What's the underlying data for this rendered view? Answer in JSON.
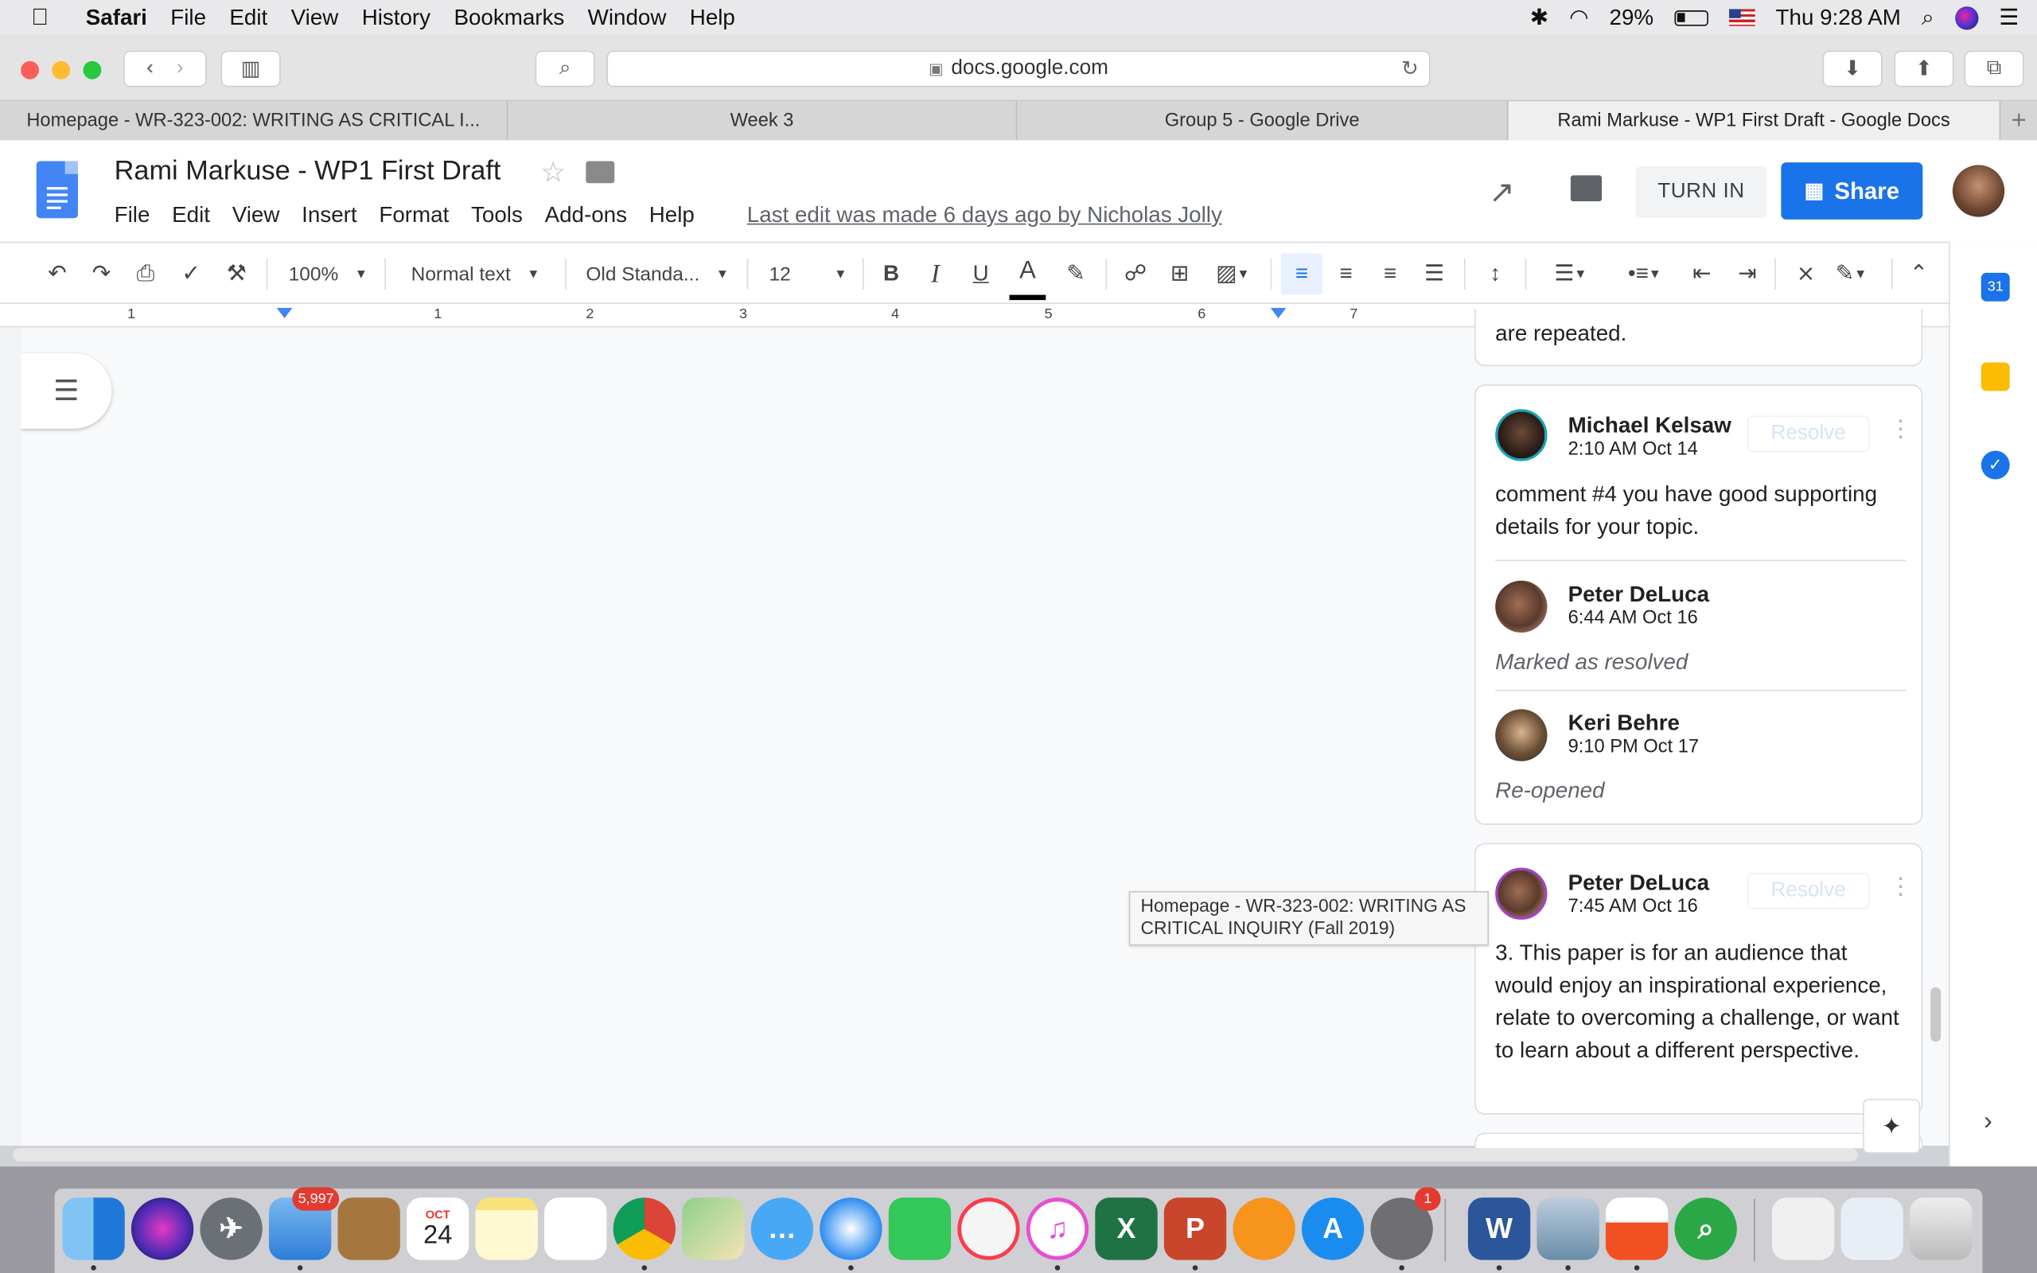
{
  "menubar": {
    "app": "Safari",
    "items": [
      "File",
      "Edit",
      "View",
      "History",
      "Bookmarks",
      "Window",
      "Help"
    ],
    "battery": "29%",
    "clock": "Thu 9:28 AM"
  },
  "safari": {
    "url": "docs.google.com",
    "tabs": [
      "Homepage - WR-323-002: WRITING AS CRITICAL I...",
      "Week 3",
      "Group 5 - Google Drive",
      "Rami Markuse - WP1 First Draft - Google Docs"
    ],
    "new_tab": "+"
  },
  "docs": {
    "title": "Rami Markuse - WP1 First Draft",
    "menu": [
      "File",
      "Edit",
      "View",
      "Insert",
      "Format",
      "Tools",
      "Add-ons",
      "Help"
    ],
    "last_edit": "Last edit was made 6 days ago by Nicholas Jolly",
    "turn_in": "TURN IN",
    "share": "Share"
  },
  "toolbar": {
    "zoom": "100%",
    "style": "Normal text",
    "font": "Old Standa...",
    "size": "12",
    "bold": "B",
    "italic": "I",
    "underline": "U",
    "text_color": "A"
  },
  "ruler": {
    "marks": [
      "1",
      "1",
      "2",
      "3",
      "4",
      "5",
      "6",
      "7"
    ]
  },
  "comments": {
    "top_fragment": "are repeated.",
    "thread1": {
      "author": "Michael Kelsaw",
      "time": "2:10 AM Oct 14",
      "resolve": "Resolve",
      "text": "comment #4 you have good supporting details for your topic.",
      "replies": [
        {
          "author": "Peter DeLuca",
          "time": "6:44 AM Oct 16",
          "status": "Marked as resolved"
        },
        {
          "author": "Keri Behre",
          "time": "9:10 PM Oct 17",
          "status": "Re-opened"
        }
      ]
    },
    "thread2": {
      "author": "Peter DeLuca",
      "time": "7:45 AM Oct 16",
      "resolve": "Resolve",
      "text": "3. This paper is for an audience that would enjoy an inspirational experience, relate to overcoming a challenge, or want to learn about a different perspective."
    }
  },
  "tooltip": "Homepage - WR-323-002: WRITING AS CRITICAL INQUIRY (Fall 2019)",
  "side_panel": {
    "calendar_day": "31"
  },
  "dock": {
    "mail_badge": "5,997",
    "calendar_month": "OCT",
    "calendar_day": "24",
    "prefs_badge": "1",
    "excel": "X",
    "powerpoint": "P",
    "word": "W"
  }
}
